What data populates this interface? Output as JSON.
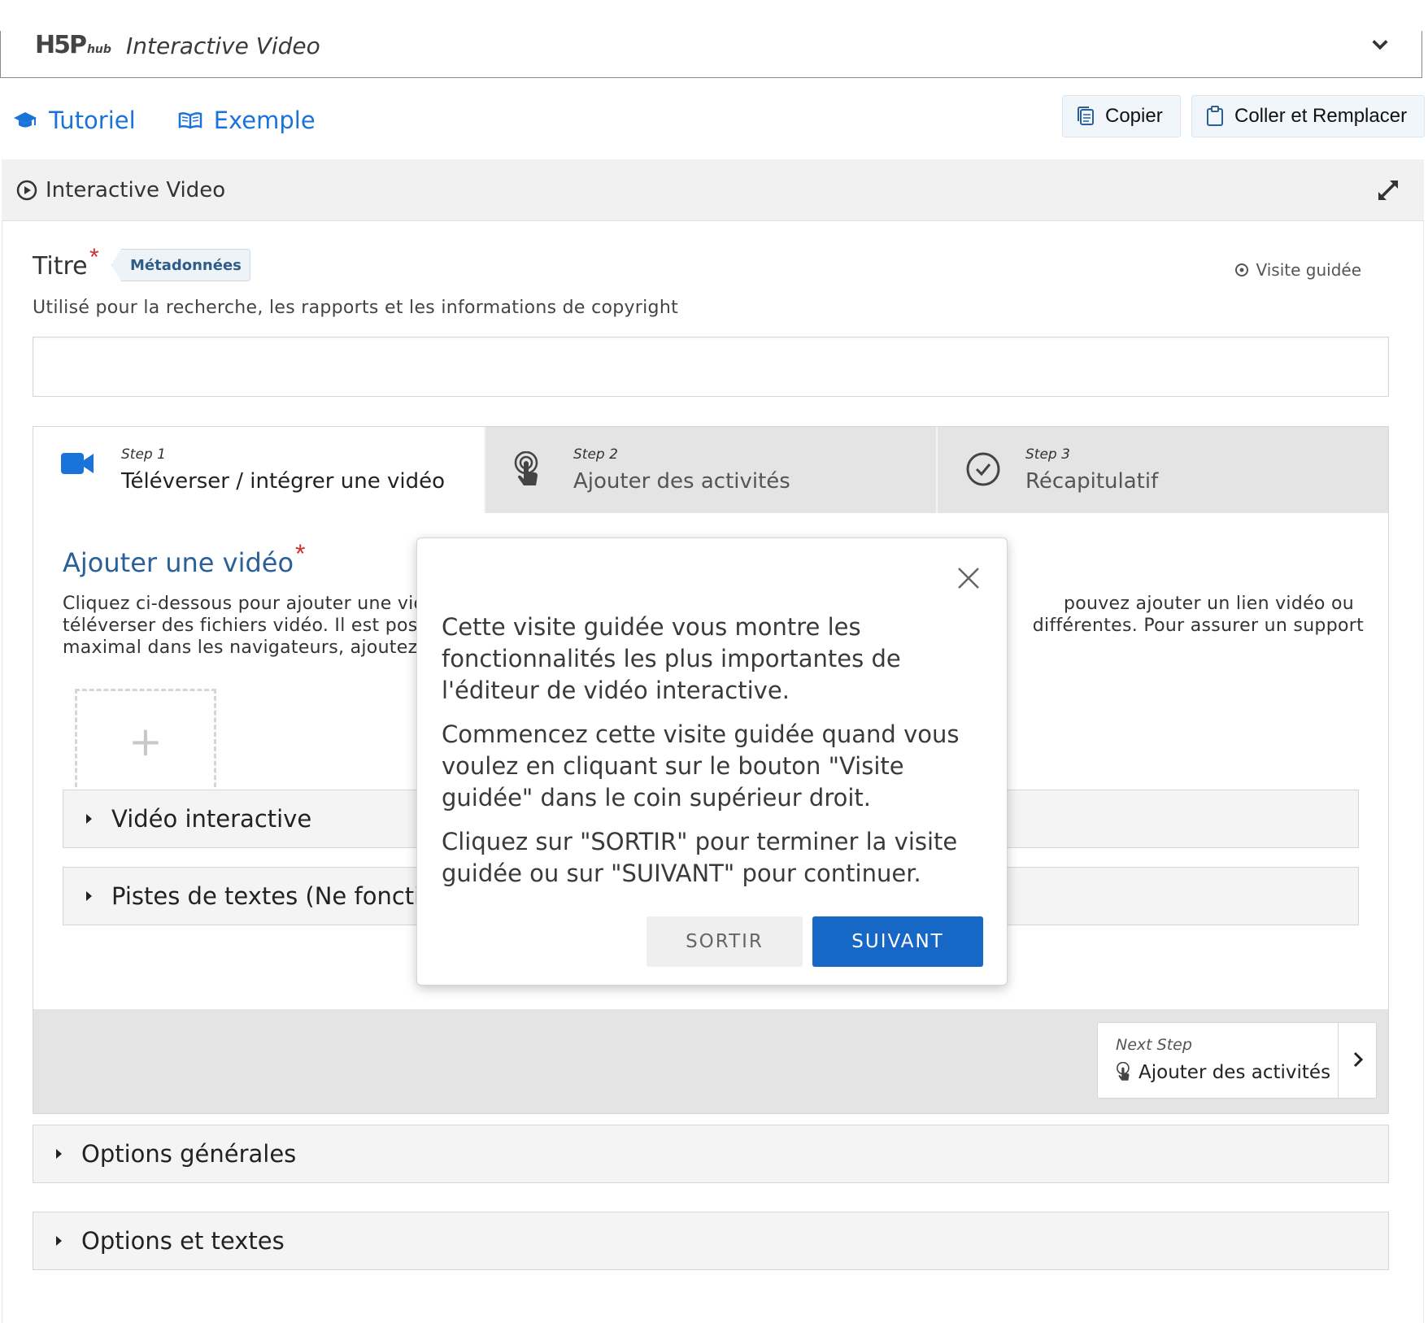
{
  "hub": {
    "logo": "H5P",
    "logo_sub": "hub",
    "content_type": "Interactive Video"
  },
  "links": {
    "tutorial": "Tutoriel",
    "example": "Exemple"
  },
  "clipboard": {
    "copy": "Copier",
    "paste_replace": "Coller et Remplacer"
  },
  "section": {
    "title": "Interactive Video"
  },
  "title_field": {
    "label": "Titre",
    "required_mark": "*",
    "metadata_button": "Métadonnées",
    "description": "Utilisé pour la recherche, les rapports et les informations de copyright",
    "value": ""
  },
  "guided_tour_link": "Visite guidée",
  "wizard": {
    "tabs": [
      {
        "step": "Step 1",
        "label": "Téléverser / intégrer une vidéo"
      },
      {
        "step": "Step 2",
        "label": "Ajouter des activités"
      },
      {
        "step": "Step 3",
        "label": "Récapitulatif"
      }
    ],
    "add_video": {
      "title": "Ajouter une vidéo",
      "required_mark": "*",
      "desc_line1_left": "Cliquez ci-dessous pour ajouter une vid",
      "desc_line1_right": "pouvez ajouter un lien vidéo ou",
      "desc_line2_left": "téléverser des fichiers vidéo. Il est poss",
      "desc_line2_right": "différentes. Pour assurer un support",
      "desc_line3_left": "maximal dans les navigateurs, ajoutez a",
      "upload_symbol": "+"
    },
    "accordions": [
      {
        "label": "Vidéo interactive"
      },
      {
        "label": "Pistes de textes (Ne fonctior"
      }
    ],
    "next_step": {
      "caption": "Next Step",
      "label": "Ajouter des activités"
    }
  },
  "outer_accordions": [
    {
      "label": "Options générales"
    },
    {
      "label": "Options et textes"
    }
  ],
  "tour": {
    "paragraphs": [
      "Cette visite guidée vous montre les fonctionnalités les plus importantes de l'éditeur de vidéo interactive.",
      "Commencez cette visite guidée quand vous voulez en cliquant sur le bouton \"Visite guidée\" dans le coin supérieur droit.",
      "Cliquez sur \"SORTIR\" pour terminer la visite guidée ou sur \"SUIVANT\" pour continuer."
    ],
    "exit_button": "SORTIR",
    "next_button": "SUIVANT"
  },
  "colors": {
    "link_blue": "#1a73d9",
    "heading_blue": "#2a5f97",
    "primary_button": "#1667c6",
    "required_red": "#d32f2f"
  },
  "icons": [
    "chevron-down-icon",
    "graduation-cap-icon",
    "open-book-icon",
    "copy-icon",
    "clipboard-icon",
    "play-circle-icon",
    "expand-icon",
    "target-icon",
    "video-camera-icon",
    "touch-hand-icon",
    "check-circle-icon",
    "close-icon",
    "chevron-right-icon"
  ]
}
